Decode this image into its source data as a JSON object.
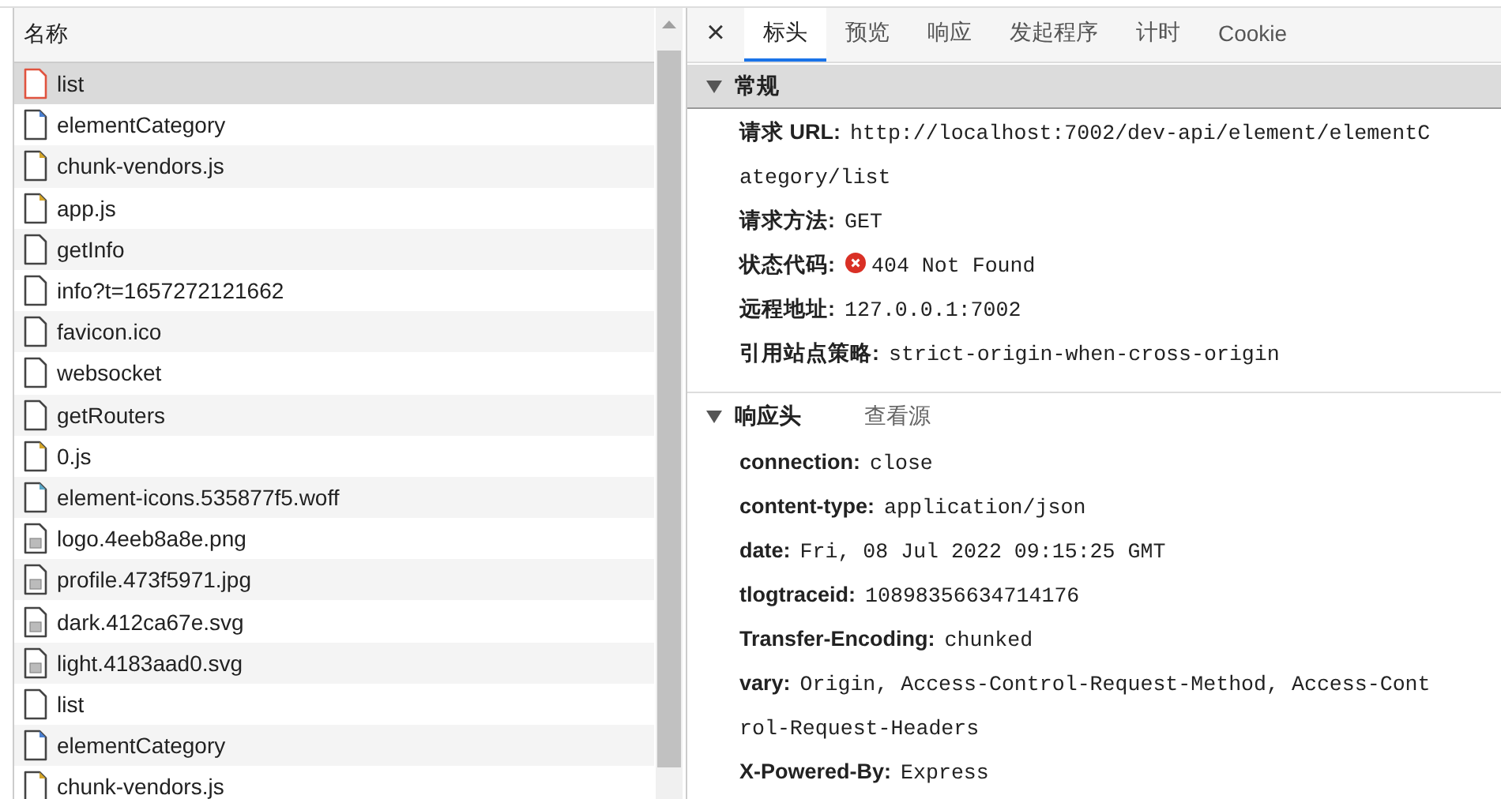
{
  "requests": {
    "column": "名称",
    "rows": [
      {
        "name": "list",
        "kind": "other",
        "failed": true,
        "selected": true
      },
      {
        "name": "elementCategory",
        "kind": "fetch",
        "failed": false,
        "selected": false
      },
      {
        "name": "chunk-vendors.js",
        "kind": "script",
        "failed": false,
        "selected": false
      },
      {
        "name": "app.js",
        "kind": "script",
        "failed": false,
        "selected": false
      },
      {
        "name": "getInfo",
        "kind": "other",
        "failed": false,
        "selected": false
      },
      {
        "name": "info?t=1657272121662",
        "kind": "other",
        "failed": false,
        "selected": false
      },
      {
        "name": "favicon.ico",
        "kind": "other",
        "failed": false,
        "selected": false
      },
      {
        "name": "websocket",
        "kind": "other",
        "failed": false,
        "selected": false
      },
      {
        "name": "getRouters",
        "kind": "other",
        "failed": false,
        "selected": false
      },
      {
        "name": "0.js",
        "kind": "script",
        "failed": false,
        "selected": false
      },
      {
        "name": "element-icons.535877f5.woff",
        "kind": "font",
        "failed": false,
        "selected": false
      },
      {
        "name": "logo.4eeb8a8e.png",
        "kind": "image",
        "failed": false,
        "selected": false
      },
      {
        "name": "profile.473f5971.jpg",
        "kind": "image",
        "failed": false,
        "selected": false
      },
      {
        "name": "dark.412ca67e.svg",
        "kind": "image",
        "failed": false,
        "selected": false
      },
      {
        "name": "light.4183aad0.svg",
        "kind": "image",
        "failed": false,
        "selected": false
      },
      {
        "name": "list",
        "kind": "other",
        "failed": false,
        "selected": false
      },
      {
        "name": "elementCategory",
        "kind": "fetch",
        "failed": false,
        "selected": false
      },
      {
        "name": "chunk-vendors.js",
        "kind": "script",
        "failed": false,
        "selected": false
      }
    ]
  },
  "details": {
    "close": "×",
    "tabs": [
      {
        "label": "标头",
        "selected": true
      },
      {
        "label": "预览",
        "selected": false
      },
      {
        "label": "响应",
        "selected": false
      },
      {
        "label": "发起程序",
        "selected": false
      },
      {
        "label": "计时",
        "selected": false
      },
      {
        "label": "Cookie",
        "selected": false
      }
    ],
    "sections": [
      {
        "title": "常规",
        "expanded": true,
        "rows": [
          {
            "key": "请求 URL:",
            "value": "http://localhost:7002/dev-api/element/elementCategory/list"
          },
          {
            "key": "请求方法:",
            "value": "GET"
          },
          {
            "key": "状态代码:",
            "value": "404 Not Found",
            "error": true
          },
          {
            "key": "远程地址:",
            "value": "127.0.0.1:7002"
          },
          {
            "key": "引用站点策略:",
            "value": "strict-origin-when-cross-origin"
          }
        ]
      },
      {
        "title": "响应头",
        "expanded": true,
        "action": "查看源",
        "rows": [
          {
            "key": "connection:",
            "value": "close"
          },
          {
            "key": "content-type:",
            "value": "application/json"
          },
          {
            "key": "date:",
            "value": "Fri, 08 Jul 2022 09:15:25 GMT"
          },
          {
            "key": "tlogtraceid:",
            "value": "10898356634714176"
          },
          {
            "key": "Transfer-Encoding:",
            "value": "chunked"
          },
          {
            "key": "vary:",
            "value": "Origin, Access-Control-Request-Method, Access-Control-Request-Headers"
          },
          {
            "key": "X-Powered-By:",
            "value": "Express"
          }
        ]
      }
    ]
  }
}
